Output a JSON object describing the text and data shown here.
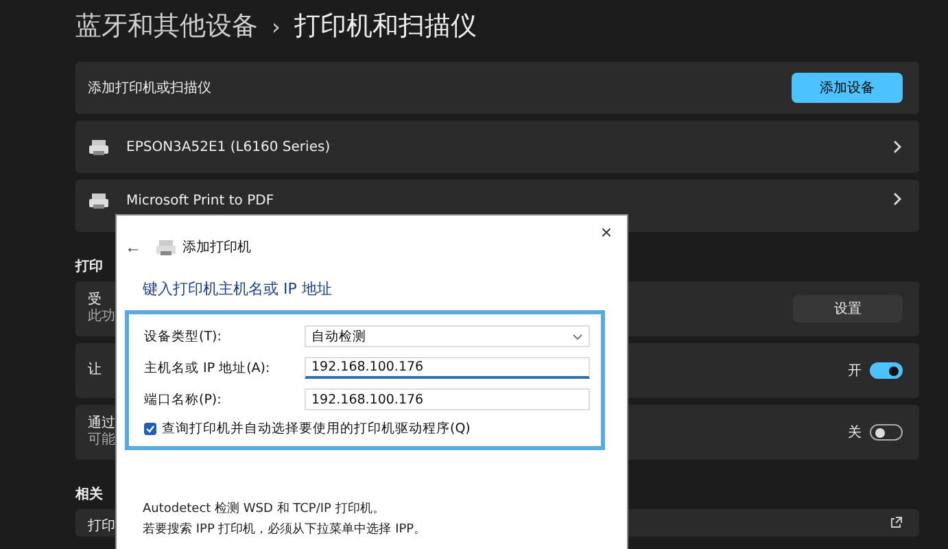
{
  "breadcrumb": {
    "parent": "蓝牙和其他设备",
    "separator": "›",
    "current": "打印机和扫描仪"
  },
  "add_row": {
    "label": "添加打印机或扫描仪",
    "button": "添加设备"
  },
  "printers": [
    {
      "name": "EPSON3A52E1 (L6160 Series)"
    },
    {
      "name": "Microsoft Print to PDF"
    }
  ],
  "printer_prefs": {
    "header": "打印",
    "rows": [
      {
        "kind": "button",
        "title": "受",
        "subtitle": "此功",
        "button": "设置"
      },
      {
        "kind": "toggle",
        "title": "让",
        "state_label": "开",
        "on": true
      },
      {
        "kind": "toggle",
        "title": "通过",
        "subtitle": "可能",
        "state_label": "关",
        "on": false
      }
    ]
  },
  "related": {
    "header": "相关",
    "rows": [
      {
        "title": "打印"
      }
    ]
  },
  "dialog": {
    "close": "×",
    "back": "←",
    "title": "添加打印机",
    "heading": "键入打印机主机名或 IP 地址",
    "fields": [
      {
        "kind": "dropdown",
        "label": "设备类型(T):",
        "value": "自动检测"
      },
      {
        "kind": "input",
        "label": "主机名或 IP 地址(A):",
        "value": "192.168.100.176",
        "focused": true
      },
      {
        "kind": "input",
        "label": "端口名称(P):",
        "value": "192.168.100.176",
        "focused": false
      }
    ],
    "checkbox": {
      "label": "查询打印机并自动选择要使用的打印机驱动程序(Q)",
      "checked": true
    },
    "notes": [
      "Autodetect 检测 WSD 和 TCP/IP 打印机。",
      "若要搜索 IPP 打印机，必须从下拉菜单中选择 IPP。"
    ]
  }
}
